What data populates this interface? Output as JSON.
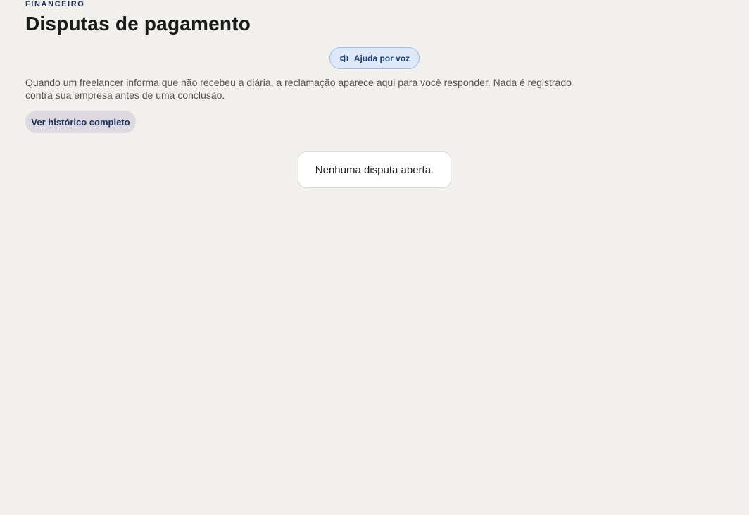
{
  "header": {
    "eyebrow": "FINANCEIRO",
    "title": "Disputas de pagamento"
  },
  "voice_help": {
    "label": "Ajuda por voz",
    "icon": "speaker-icon"
  },
  "description": "Quando um freelancer informa que não recebeu a diária, a reclamação aparece aqui para você responder. Nada é registrado contra sua empresa antes de uma conclusão.",
  "history_button": {
    "label": "Ver histórico completo"
  },
  "empty_state": {
    "message": "Nenhuma disputa aberta."
  },
  "colors": {
    "background": "#f2f0ec",
    "accent_dark": "#1f2f5c",
    "voice_button_bg": "#dde9f8",
    "voice_button_border": "#9cc0ea"
  }
}
